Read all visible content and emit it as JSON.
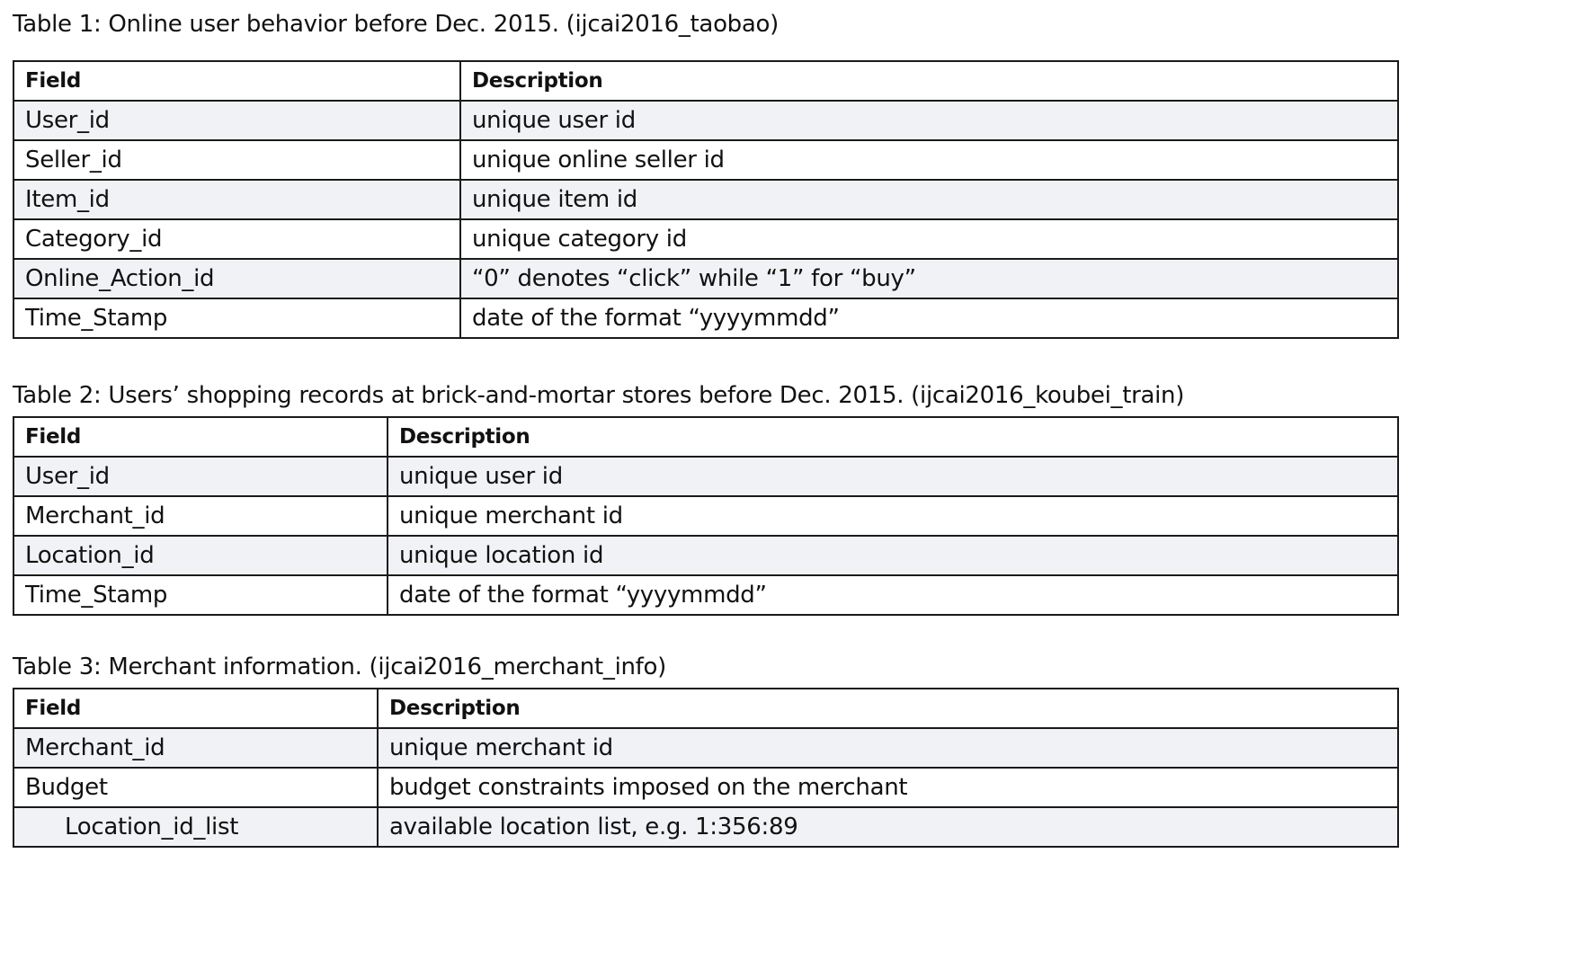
{
  "table1": {
    "caption": "Table 1: Online user behavior before Dec. 2015. (ijcai2016_taobao)",
    "headers": {
      "field": "Field",
      "description": "Description"
    },
    "rows": [
      {
        "field": "User_id",
        "description": "unique user id"
      },
      {
        "field": "Seller_id",
        "description": "unique online seller id"
      },
      {
        "field": "Item_id",
        "description": "unique item id"
      },
      {
        "field": "Category_id",
        "description": "unique category id"
      },
      {
        "field": "Online_Action_id",
        "description": "“0” denotes “click” while “1” for “buy”"
      },
      {
        "field": "Time_Stamp",
        "description": "date of the format “yyyymmdd”"
      }
    ]
  },
  "table2": {
    "caption": "Table 2: Users’ shopping records at brick-and-mortar stores before Dec. 2015. (ijcai2016_koubei_train)",
    "headers": {
      "field": "Field",
      "description": "Description"
    },
    "rows": [
      {
        "field": "User_id",
        "description": "unique user id"
      },
      {
        "field": "Merchant_id",
        "description": "unique merchant id"
      },
      {
        "field": "Location_id",
        "description": "unique location id"
      },
      {
        "field": "Time_Stamp",
        "description": "date of the format “yyyymmdd”"
      }
    ]
  },
  "table3": {
    "caption": "Table 3: Merchant information. (ijcai2016_merchant_info)",
    "headers": {
      "field": "Field",
      "description": "Description"
    },
    "rows": [
      {
        "field": "Merchant_id",
        "description": "unique merchant id"
      },
      {
        "field": "Budget",
        "description": "budget constraints imposed on the merchant"
      },
      {
        "field": "Location_id_list",
        "description": "available location list, e.g. 1:356:89"
      }
    ]
  }
}
